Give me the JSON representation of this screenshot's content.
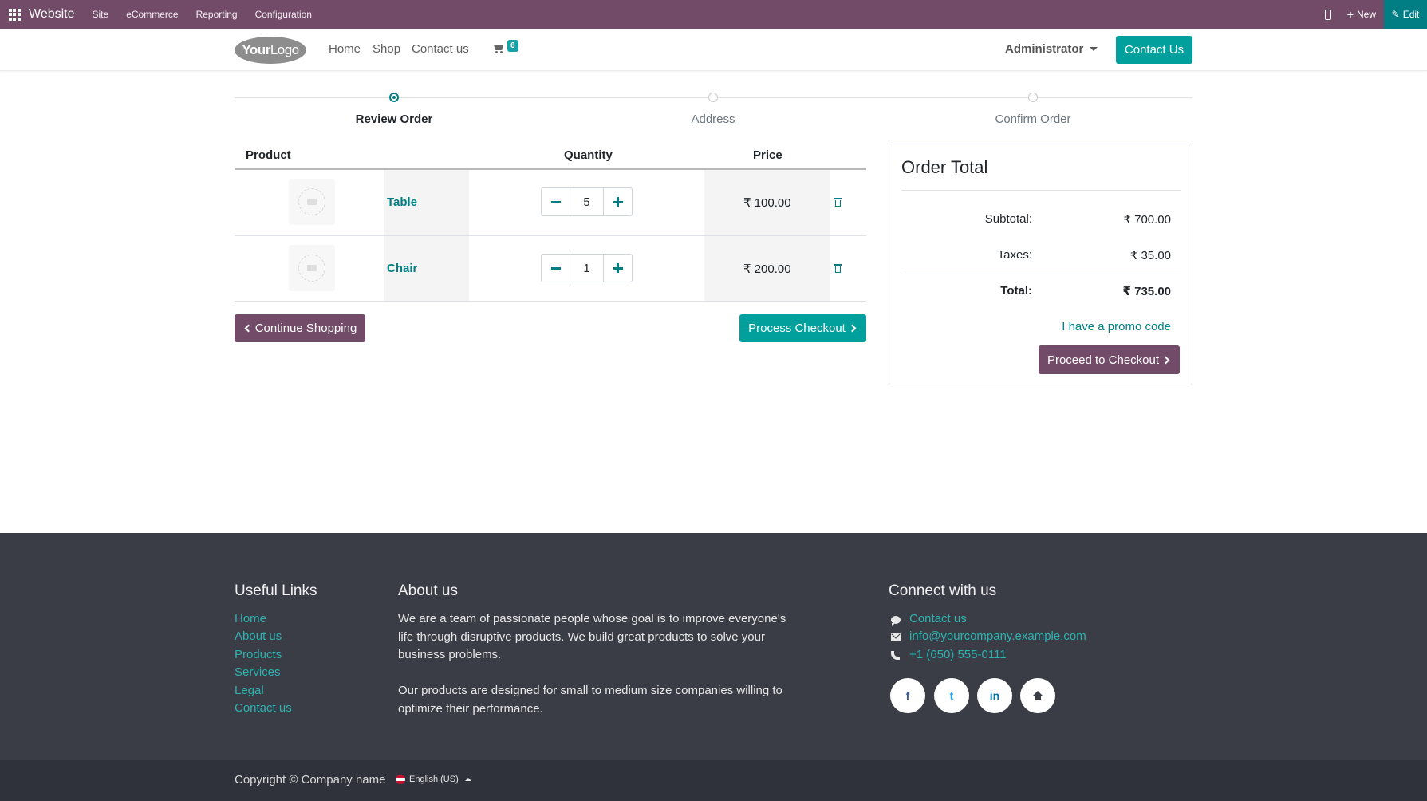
{
  "adminbar": {
    "brand": "Website",
    "menus": [
      "Site",
      "eCommerce",
      "Reporting",
      "Configuration"
    ],
    "new_label": "New",
    "edit_label": "Edit"
  },
  "header": {
    "logo_text_bold": "Your",
    "logo_text_light": "Logo",
    "nav": [
      "Home",
      "Shop",
      "Contact us"
    ],
    "cart_count": "6",
    "user": "Administrator",
    "contact_button": "Contact Us"
  },
  "wizard": {
    "steps": [
      {
        "label": "Review Order",
        "active": true
      },
      {
        "label": "Address",
        "active": false
      },
      {
        "label": "Confirm Order",
        "active": false
      }
    ]
  },
  "cart": {
    "columns": {
      "product": "Product",
      "quantity": "Quantity",
      "price": "Price"
    },
    "lines": [
      {
        "name": "Table",
        "quantity": "5",
        "price": "₹ 100.00"
      },
      {
        "name": "Chair",
        "quantity": "1",
        "price": "₹ 200.00"
      }
    ],
    "continue_label": "Continue Shopping",
    "process_label": "Process Checkout"
  },
  "order_total": {
    "title": "Order Total",
    "subtotal_label": "Subtotal:",
    "subtotal": "₹ 700.00",
    "taxes_label": "Taxes:",
    "taxes": "₹ 35.00",
    "total_label": "Total:",
    "total": "₹ 735.00",
    "promo_label": "I have a promo code",
    "proceed_label": "Proceed to Checkout"
  },
  "footer": {
    "useful_links_title": "Useful Links",
    "useful_links": [
      "Home",
      "About us",
      "Products",
      "Services",
      "Legal",
      "Contact us"
    ],
    "about_title": "About us",
    "about_p1": "We are a team of passionate people whose goal is to improve everyone's life through disruptive products. We build great products to solve your business problems.",
    "about_p2": "Our products are designed for small to medium size companies willing to optimize their performance.",
    "connect_title": "Connect with us",
    "connect_contact": "Contact us",
    "connect_email": "info@yourcompany.example.com",
    "connect_phone": "+1 (650) 555-0111",
    "social": [
      "f",
      "t",
      "in",
      "home"
    ],
    "copyright": "Copyright © Company name",
    "language": "English (US)"
  },
  "colors": {
    "admin_bar": "#714b67",
    "primary": "#01a09d",
    "secondary": "#714b67",
    "link": "#017e84",
    "footer_bg": "#3a3c46"
  }
}
